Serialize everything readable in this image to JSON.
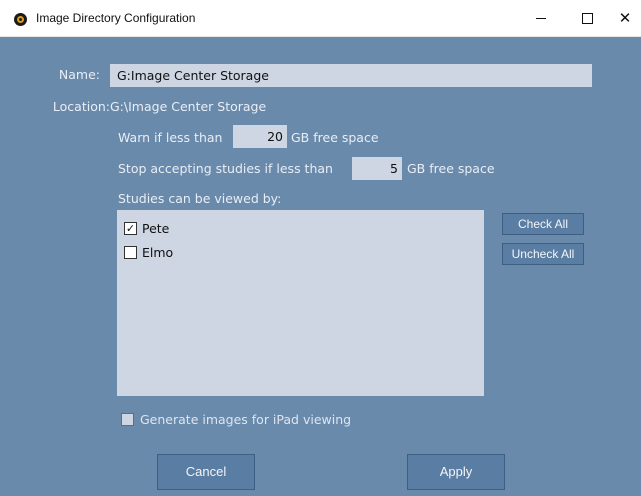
{
  "window": {
    "title": "Image Directory Configuration",
    "minimize_glyph": "–",
    "maximize_glyph": "☐",
    "close_glyph": "✕"
  },
  "form": {
    "name_label": "Name:",
    "name_value": "G:Image Center Storage",
    "location_label": "Location:",
    "location_value": "G:\\Image Center Storage",
    "warn_prefix": "Warn if less than",
    "warn_value": "20",
    "warn_suffix": "GB free space",
    "stop_prefix": "Stop accepting studies if less than",
    "stop_value": "5",
    "stop_suffix": "GB free space",
    "viewers_label": "Studies can be viewed by:",
    "viewers": [
      {
        "name": "Pete",
        "checked": true,
        "mark": "✓"
      },
      {
        "name": "Elmo",
        "checked": false,
        "mark": ""
      }
    ],
    "check_all_label": "Check All",
    "uncheck_all_label": "Uncheck All",
    "ipad_label": "Generate images for iPad viewing",
    "ipad_checked": false
  },
  "actions": {
    "cancel_label": "Cancel",
    "apply_label": "Apply"
  },
  "colors": {
    "dialog_background": "#6a8aac",
    "field_background": "#cdd6e2",
    "button_background": "#5a7da3"
  }
}
